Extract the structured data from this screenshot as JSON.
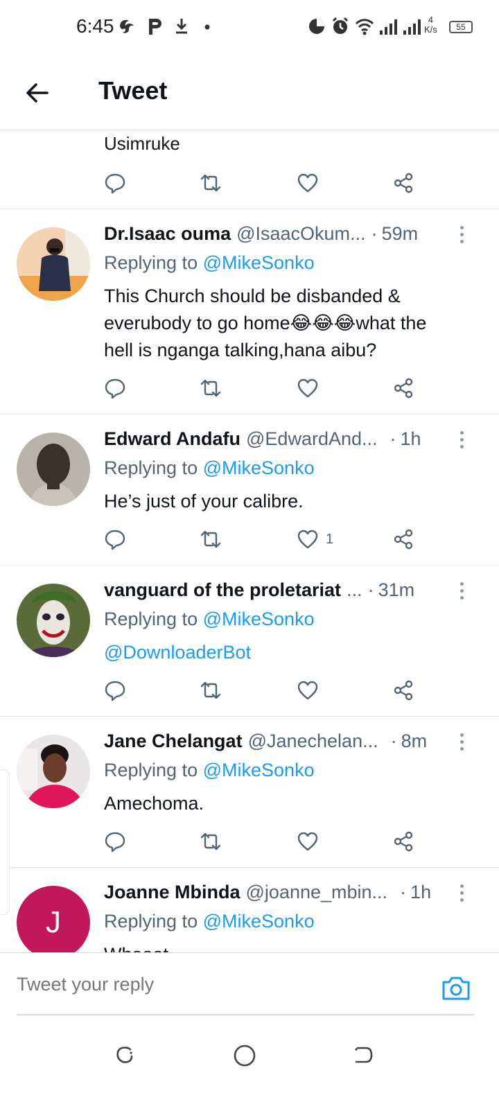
{
  "status_bar": {
    "time": "6:45",
    "net_speed_value": "4",
    "net_speed_unit": "K/s",
    "battery": "55"
  },
  "header": {
    "title": "Tweet"
  },
  "partial_tweet": {
    "text": "Usimruke"
  },
  "tweets": [
    {
      "name": "Dr.Isaac ouma",
      "handle": "@IsaacOkum...",
      "time": "59m",
      "replying_label": "Replying to",
      "replying_to": "@MikeSonko",
      "text_lines": [
        "This Church should be disbanded &",
        "everubody to go home😂😂😂what the",
        "hell is nganga talking,hana aibu?"
      ],
      "likes": ""
    },
    {
      "name": "Edward Andafu",
      "handle": "@EdwardAnd...",
      "time": "1h",
      "replying_label": "Replying to",
      "replying_to": "@MikeSonko",
      "text_lines": [
        "He’s just of your calibre."
      ],
      "likes": "1"
    },
    {
      "name": "vanguard of the proletariat",
      "handle": "...",
      "time": "31m",
      "replying_label": "Replying to",
      "replying_to": "@MikeSonko",
      "text_lines": [
        "@DownloaderBot"
      ],
      "likes": ""
    },
    {
      "name": "Jane Chelangat",
      "handle": "@Janechelan...",
      "time": "8m",
      "replying_label": "Replying to",
      "replying_to": "@MikeSonko",
      "text_lines": [
        "Amechoma."
      ],
      "likes": ""
    },
    {
      "name": "Joanne Mbinda",
      "handle": "@joanne_mbin...",
      "time": "1h",
      "replying_label": "Replying to",
      "replying_to": "@MikeSonko",
      "text_lines": [
        "Whaaat"
      ],
      "avatar_letter": "J",
      "likes": ""
    }
  ],
  "reply_bar": {
    "placeholder": "Tweet your reply"
  },
  "colors": {
    "accent": "#1d9bf0",
    "secondary_text": "#536471",
    "avatar_j": "#c2185b"
  },
  "icons": [
    "back-arrow-icon",
    "reply-icon",
    "retweet-icon",
    "like-icon",
    "share-icon",
    "more-icon",
    "camera-icon",
    "recents-icon",
    "home-icon",
    "back-nav-icon"
  ]
}
